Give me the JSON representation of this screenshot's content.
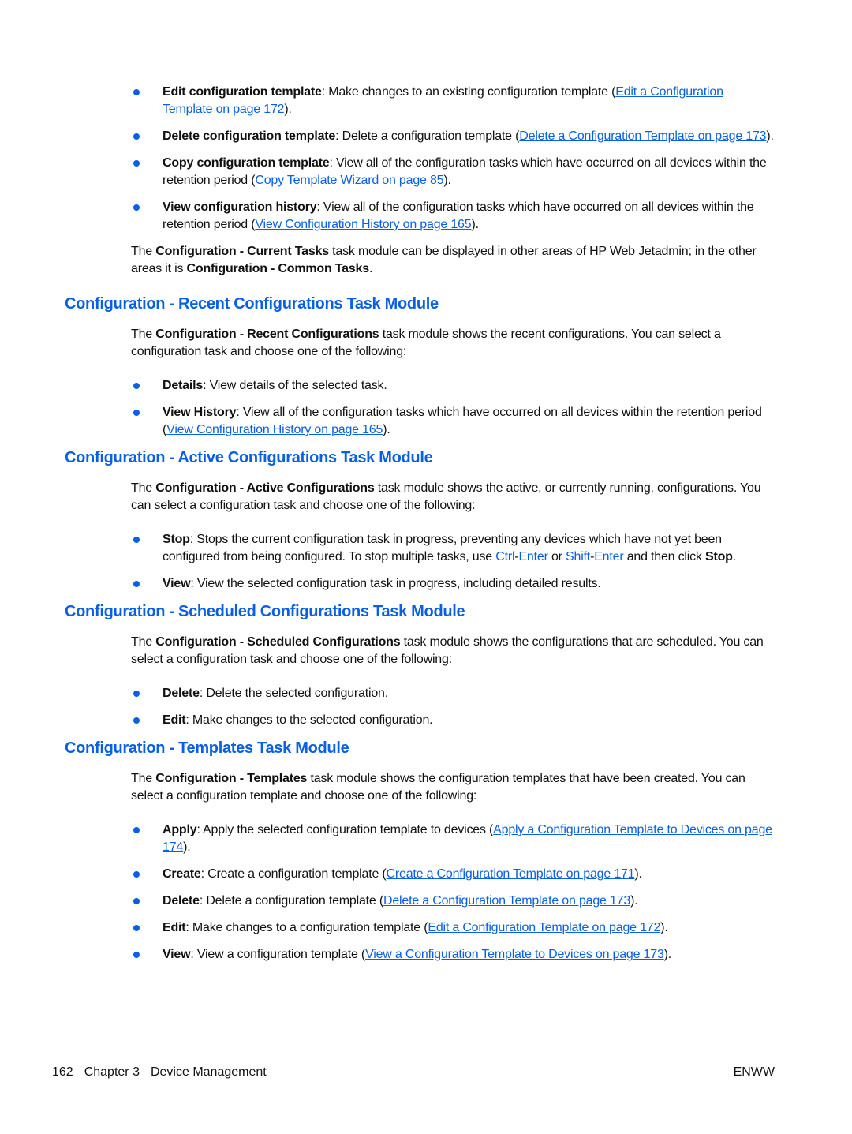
{
  "intro_bullets": [
    {
      "bold": "Edit configuration template",
      "text": ": Make changes to an existing configuration template (",
      "link": "Edit a Configuration Template on page 172",
      "end": ")."
    },
    {
      "bold": "Delete configuration template",
      "text": ": Delete a configuration template (",
      "link": "Delete a Configuration Template on page 173",
      "end": ")."
    },
    {
      "bold": "Copy configuration template",
      "text": ": View all of the configuration tasks which have occurred on all devices within the retention period (",
      "link": "Copy Template Wizard on page 85",
      "end": ")."
    },
    {
      "bold": "View configuration history",
      "text": ": View all of the configuration tasks which have occurred on all devices within the retention period (",
      "link": "View Configuration History on page 165",
      "end": ")."
    }
  ],
  "current_tasks_note": {
    "t1": "The ",
    "b1": "Configuration - Current Tasks",
    "t2": " task module can be displayed in other areas of HP Web Jetadmin; in the other areas it is ",
    "b2": "Configuration - Common Tasks",
    "t3": "."
  },
  "sections": {
    "recent": {
      "heading": "Configuration - Recent Configurations Task Module",
      "intro_t1": "The ",
      "intro_b": "Configuration - Recent Configurations",
      "intro_t2": " task module shows the recent configurations. You can select a configuration task and choose one of the following:",
      "bullets": [
        {
          "bold": "Details",
          "text": ": View details of the selected task."
        },
        {
          "bold": "View History",
          "text": ": View all of the configuration tasks which have occurred on all devices within the retention period (",
          "link": "View Configuration History on page 165",
          "end": ")."
        }
      ]
    },
    "active": {
      "heading": "Configuration - Active Configurations Task Module",
      "intro_t1": "The ",
      "intro_b": "Configuration - Active Configurations",
      "intro_t2": " task module shows the active, or currently running, configurations. You can select a configuration task and choose one of the following:",
      "stop": {
        "bold": "Stop",
        "t1": ": Stops the current configuration task in progress, preventing any devices which have not yet been configured from being configured. To stop multiple tasks, use ",
        "k1": "Ctrl",
        "dash1": "-",
        "k2": "Enter",
        "t2": " or ",
        "k3": "Shift",
        "dash2": "-",
        "k4": "Enter",
        "t3": " and then click ",
        "b2": "Stop",
        "t4": "."
      },
      "view": {
        "bold": "View",
        "text": ": View the selected configuration task in progress, including detailed results."
      }
    },
    "scheduled": {
      "heading": "Configuration - Scheduled Configurations Task Module",
      "intro_t1": "The ",
      "intro_b": "Configuration - Scheduled Configurations",
      "intro_t2": " task module shows the configurations that are scheduled. You can select a configuration task and choose one of the following:",
      "bullets": [
        {
          "bold": "Delete",
          "text": ": Delete the selected configuration."
        },
        {
          "bold": "Edit",
          "text": ": Make changes to the selected configuration."
        }
      ]
    },
    "templates": {
      "heading": "Configuration - Templates Task Module",
      "intro_t1": "The ",
      "intro_b": "Configuration - Templates",
      "intro_t2": " task module shows the configuration templates that have been created. You can select a configuration template and choose one of the following:",
      "bullets": [
        {
          "bold": "Apply",
          "text": ": Apply the selected configuration template to devices (",
          "link": "Apply a Configuration Template to Devices on page 174",
          "end": ")."
        },
        {
          "bold": "Create",
          "text": ": Create a configuration template (",
          "link": "Create a Configuration Template on page 171",
          "end": ")."
        },
        {
          "bold": "Delete",
          "text": ": Delete a configuration template (",
          "link": "Delete a Configuration Template on page 173",
          "end": ")."
        },
        {
          "bold": "Edit",
          "text": ": Make changes to a configuration template (",
          "link": "Edit a Configuration Template on page 172",
          "end": ")."
        },
        {
          "bold": "View",
          "text": ": View a configuration template (",
          "link": "View a Configuration Template to Devices on page 173",
          "end": ")."
        }
      ]
    }
  },
  "footer": {
    "page_number": "162",
    "chapter": "Chapter 3",
    "chapter_title": "Device Management",
    "right": "ENWW"
  }
}
